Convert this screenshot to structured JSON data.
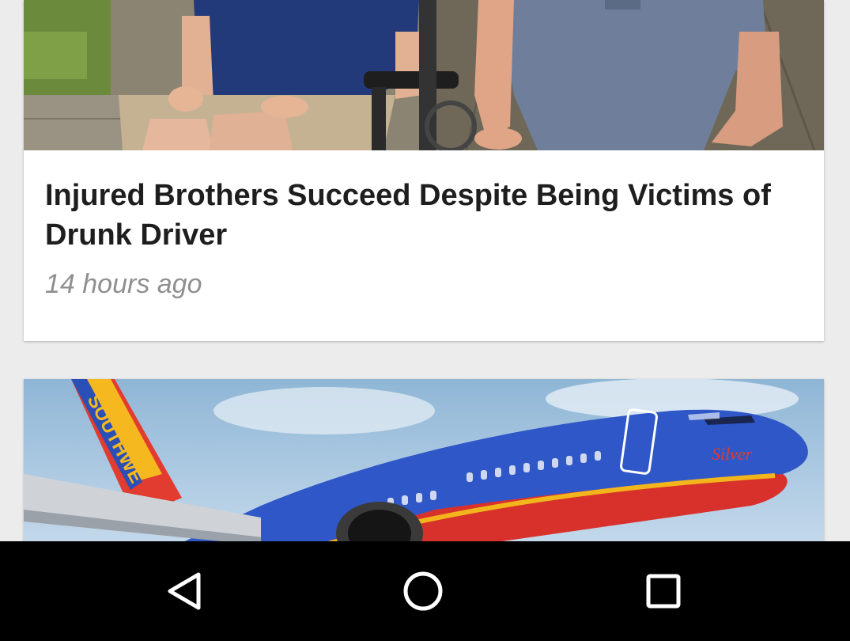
{
  "feed": {
    "articles": [
      {
        "image_alt": "",
        "title": "Injured Brothers Succeed Despite Being Victims of Drunk Driver",
        "time": "14 hours ago"
      },
      {
        "image_alt": "",
        "title": "",
        "time": ""
      }
    ]
  },
  "airplane_livery": {
    "tail_text": "SOUTHWE",
    "nose_text": "Silver"
  },
  "navigation_bar": {
    "back_icon": "back-triangle-icon",
    "home_icon": "home-circle-icon",
    "recents_icon": "recents-square-icon"
  },
  "colors": {
    "background": "#ececec",
    "card": "#ffffff",
    "title_text": "#1e1e1e",
    "meta_text": "#8f8f8f",
    "nav_bar": "#000000",
    "nav_icon": "#ffffff"
  }
}
